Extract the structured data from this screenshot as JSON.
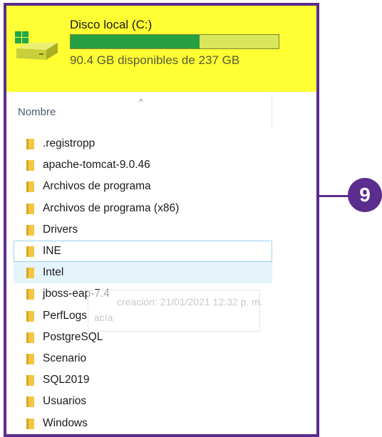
{
  "drive": {
    "name": "Disco local (C:)",
    "free_text": "90.4 GB disponibles de 237 GB",
    "used_fraction": 0.62,
    "icon": "hard-drive-windows-icon"
  },
  "column_header": {
    "name_label": "Nombre",
    "sort_indicator": "^"
  },
  "files": [
    {
      "name": ".registropp"
    },
    {
      "name": "apache-tomcat-9.0.46"
    },
    {
      "name": "Archivos de programa"
    },
    {
      "name": "Archivos de programa (x86)"
    },
    {
      "name": "Drivers"
    },
    {
      "name": "INE"
    },
    {
      "name": "Intel"
    },
    {
      "name": "jboss-eap-7.4"
    },
    {
      "name": "PerfLogs"
    },
    {
      "name": "PostgreSQL"
    },
    {
      "name": "Scenario"
    },
    {
      "name": "SQL2019"
    },
    {
      "name": "Usuarios"
    },
    {
      "name": "Windows"
    }
  ],
  "tooltip": {
    "line1": "creación: 21/01/2021 12:32 p. m.",
    "line2": "acía"
  },
  "annotation": {
    "step_number": "9"
  },
  "colors": {
    "highlight": "#ffff33",
    "frame": "#5b2d8e",
    "capacity_used": "#26a041",
    "folder": "#f2c744"
  }
}
